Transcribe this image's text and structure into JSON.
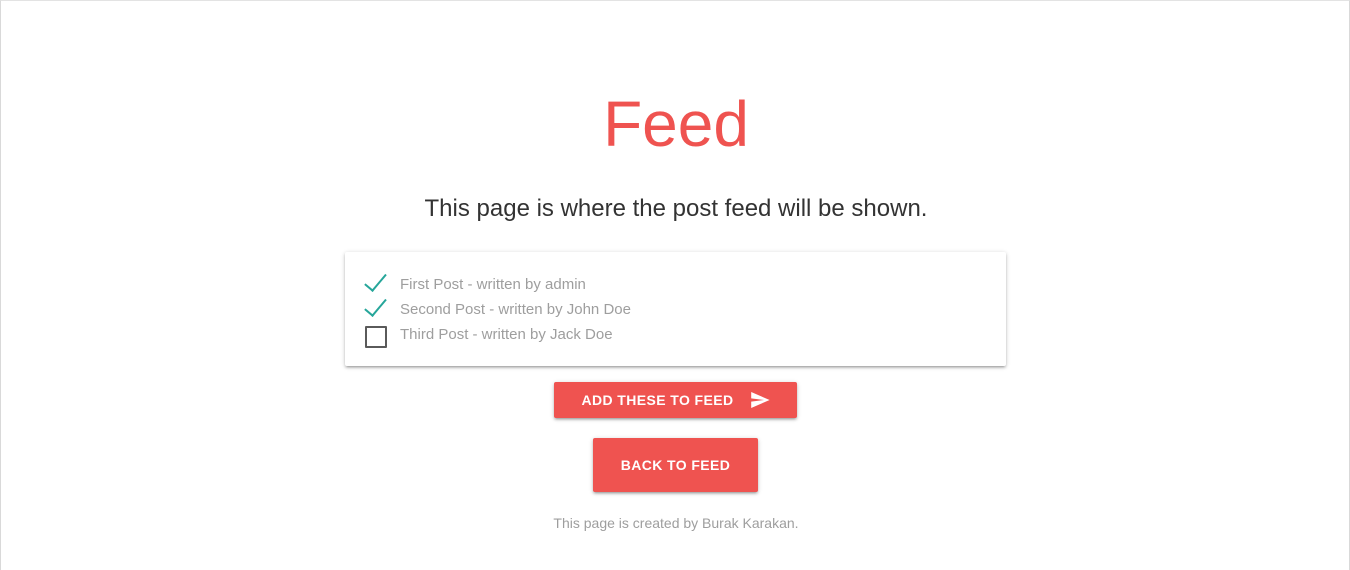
{
  "page": {
    "title": "Feed",
    "subtitle": "This page is where the post feed will be shown.",
    "footer": "This page is created by Burak Karakan."
  },
  "posts": [
    {
      "label": "First Post - written by admin",
      "checked": true
    },
    {
      "label": "Second Post - written by John Doe",
      "checked": true
    },
    {
      "label": "Third Post - written by Jack Doe",
      "checked": false
    }
  ],
  "buttons": {
    "add_label": "ADD THESE TO FEED",
    "add_icon": "send-icon",
    "back_label": "BACK TO FEED"
  },
  "colors": {
    "accent": "#ef5350",
    "check": "#26a69a",
    "muted_text": "#9e9e9e"
  }
}
